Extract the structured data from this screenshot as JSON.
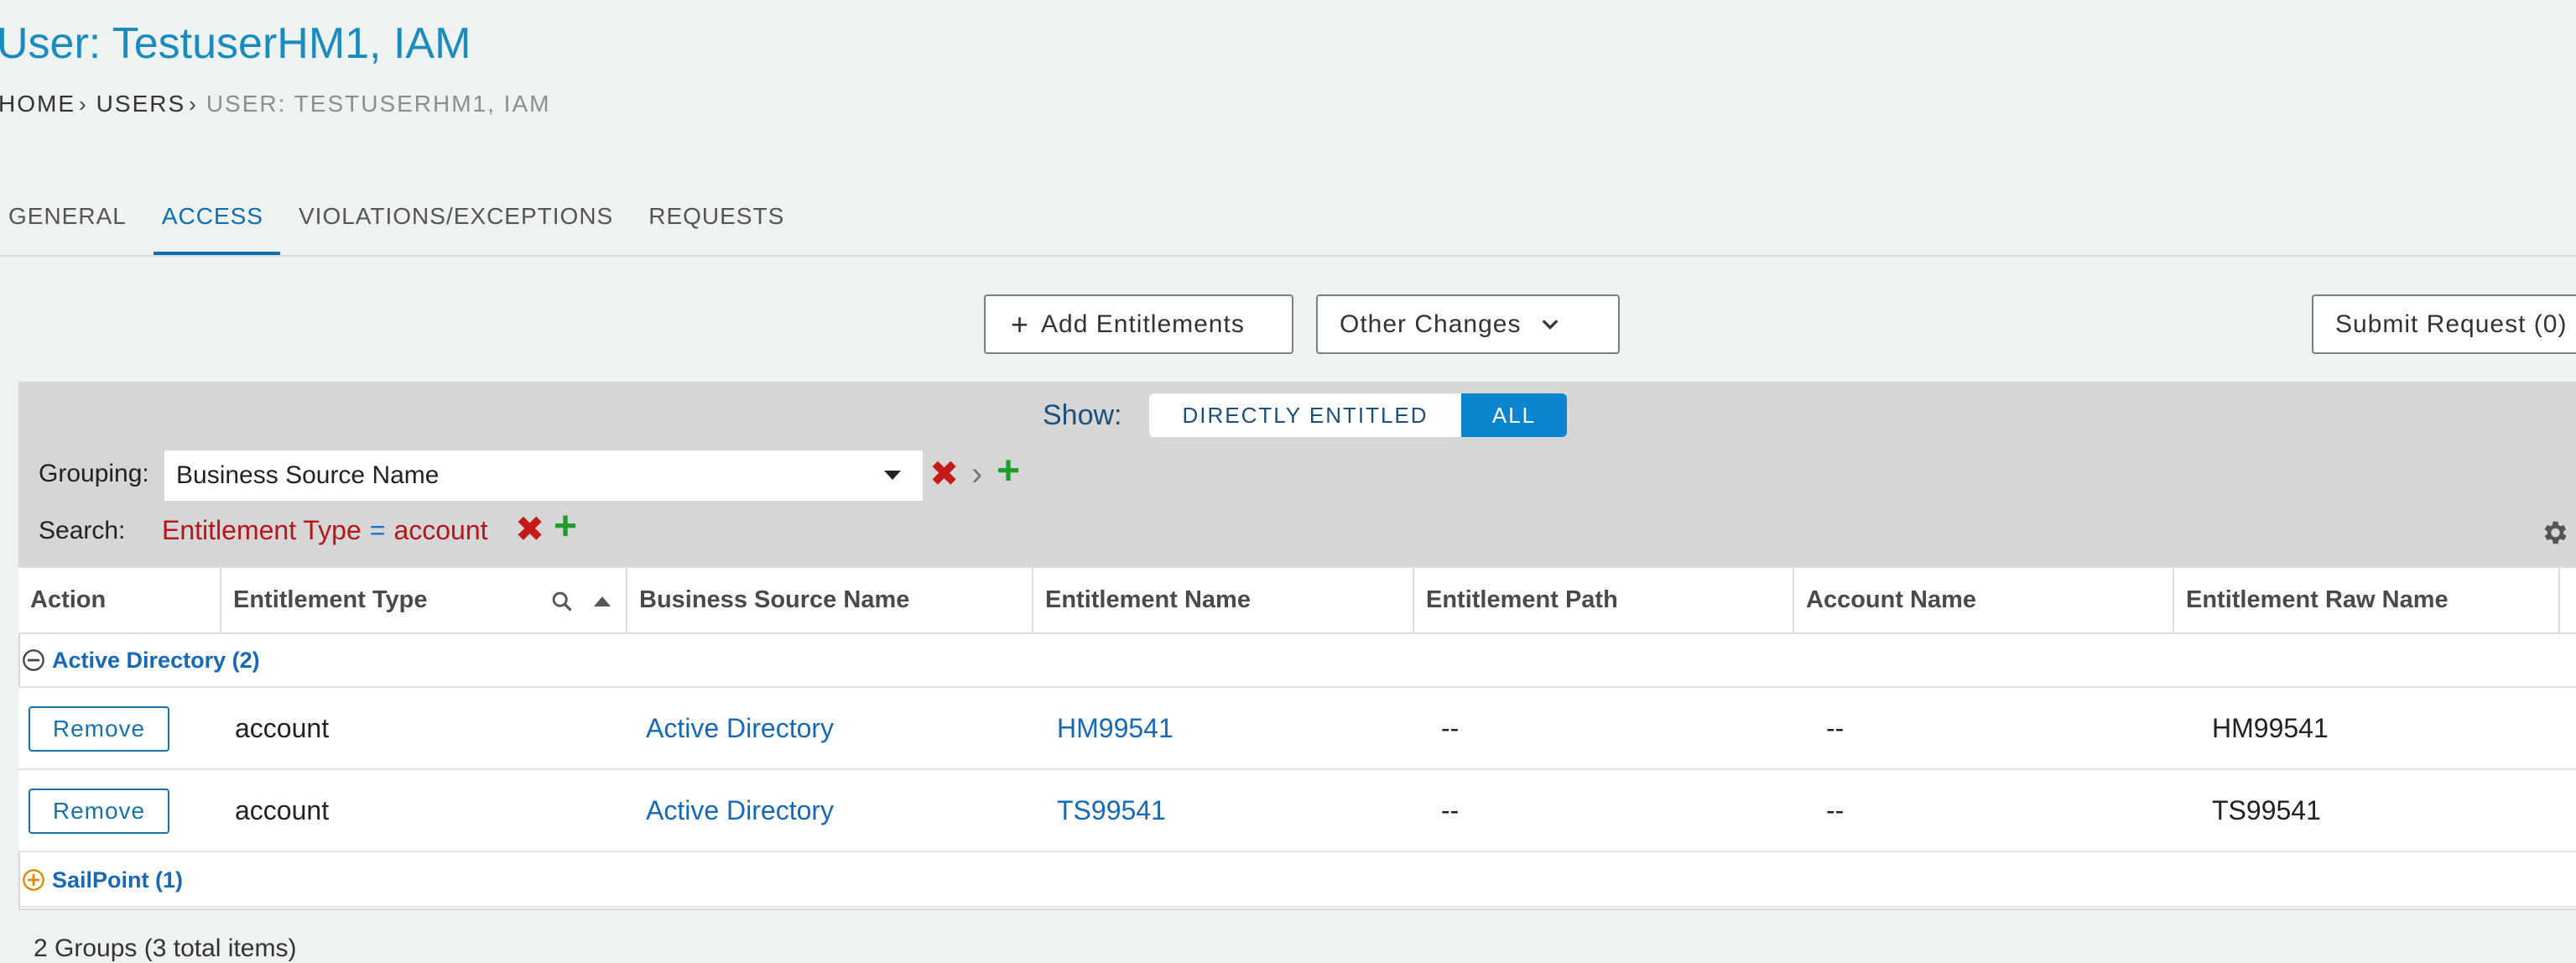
{
  "page": {
    "title": "User: TestuserHM1, IAM",
    "breadcrumb": {
      "home": "HOME",
      "users": "USERS",
      "current": "USER: TESTUSERHM1, IAM"
    }
  },
  "tabs": [
    {
      "label": "GENERAL",
      "active": false
    },
    {
      "label": "ACCESS",
      "active": true
    },
    {
      "label": "VIOLATIONS/EXCEPTIONS",
      "active": false
    },
    {
      "label": "REQUESTS",
      "active": false
    }
  ],
  "toolbar": {
    "add_label": "Add Entitlements",
    "other_label": "Other Changes",
    "submit_label": "Submit Request (0)"
  },
  "filters": {
    "show_label": "Show:",
    "show_options": [
      "DIRECTLY ENTITLED",
      "ALL"
    ],
    "show_selected": "ALL",
    "grouping_label": "Grouping:",
    "grouping_value": "Business Source Name",
    "search_label": "Search:",
    "search_filter": {
      "field": "Entitlement Type",
      "operator": "=",
      "value": "account"
    }
  },
  "table": {
    "columns": [
      "Action",
      "Entitlement Type",
      "Business Source Name",
      "Entitlement Name",
      "Entitlement Path",
      "Account Name",
      "Entitlement Raw Name"
    ],
    "groups": [
      {
        "label": "Active Directory (2)",
        "expanded": true,
        "rows": [
          {
            "action": "Remove",
            "entitlement_type": "account",
            "business_source": "Active Directory",
            "entitlement_name": "HM99541",
            "entitlement_path": "--",
            "account_name": "--",
            "raw_name": "HM99541"
          },
          {
            "action": "Remove",
            "entitlement_type": "account",
            "business_source": "Active Directory",
            "entitlement_name": "TS99541",
            "entitlement_path": "--",
            "account_name": "--",
            "raw_name": "TS99541"
          }
        ]
      },
      {
        "label": "SailPoint (1)",
        "expanded": false,
        "rows": []
      }
    ]
  },
  "footer": {
    "summary": "2 Groups (3 total items)"
  },
  "colors": {
    "accent": "#0b6fb0",
    "title": "#1a8bbf",
    "danger": "#c41a1a",
    "success": "#1f9c2c",
    "expand": "#e08a00"
  }
}
